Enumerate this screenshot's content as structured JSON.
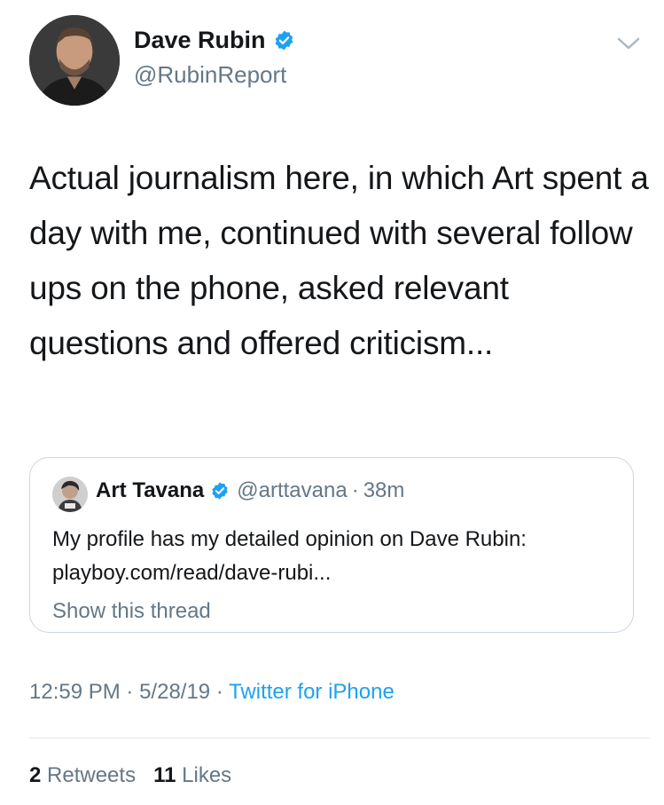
{
  "author": {
    "name": "Dave Rubin",
    "handle": "@RubinReport",
    "avatar_icon": "person-avatar",
    "verified_icon": "verified-badge-icon"
  },
  "tweet": {
    "text": "Actual journalism here, in which Art spent a day with me, continued with several follow ups on the phone, asked relevant questions and offered criticism..."
  },
  "quoted_tweet": {
    "name": "Art Tavana",
    "handle": "@arttavana",
    "separator": "·",
    "time": "38m",
    "text": "My profile has my detailed opinion on Dave Rubin: playboy.com/read/dave-rubi...",
    "show_thread": "Show this thread"
  },
  "meta": {
    "time": "12:59 PM",
    "sep1": "·",
    "date": "5/28/19",
    "sep2": "·",
    "source": "Twitter for iPhone"
  },
  "stats": {
    "retweets_count": "2",
    "retweets_label": "Retweets",
    "likes_count": "11",
    "likes_label": "Likes"
  },
  "colors": {
    "accent": "#1da1f2",
    "secondary_text": "#657786",
    "primary_text": "#14171a",
    "border": "#ccd6dd"
  }
}
